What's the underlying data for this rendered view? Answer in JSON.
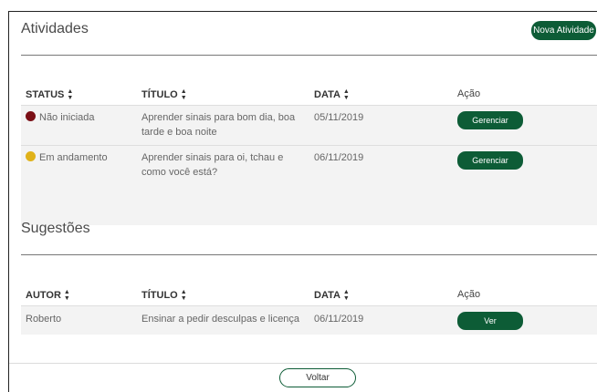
{
  "activities": {
    "title": "Atividades",
    "new_button": "Nova Atividade",
    "headers": {
      "status": "STATUS",
      "title": "TÍTULO",
      "date": "DATA",
      "action": "Ação"
    },
    "rows": [
      {
        "status": "Não iniciada",
        "status_color": "#7a0f16",
        "title": "Aprender sinais para bom dia, boa tarde e boa noite",
        "date": "05/11/2019",
        "action": "Gerenciar"
      },
      {
        "status": "Em andamento",
        "status_color": "#e0b21a",
        "title": "Aprender sinais para oi, tchau e como você está?",
        "date": "06/11/2019",
        "action": "Gerenciar"
      }
    ]
  },
  "suggestions": {
    "title": "Sugestões",
    "headers": {
      "author": "AUTOR",
      "title": "TÍTULO",
      "date": "DATA",
      "action": "Ação"
    },
    "rows": [
      {
        "author": "Roberto",
        "title": "Ensinar a pedir desculpas e licença",
        "date": "06/11/2019",
        "action": "Ver"
      }
    ]
  },
  "footer": {
    "back_button": "Voltar"
  },
  "colors": {
    "primary": "#0d5c36",
    "status_not_started": "#7a0f16",
    "status_in_progress": "#e0b21a"
  },
  "icons": {
    "sort": "sort-icon"
  }
}
